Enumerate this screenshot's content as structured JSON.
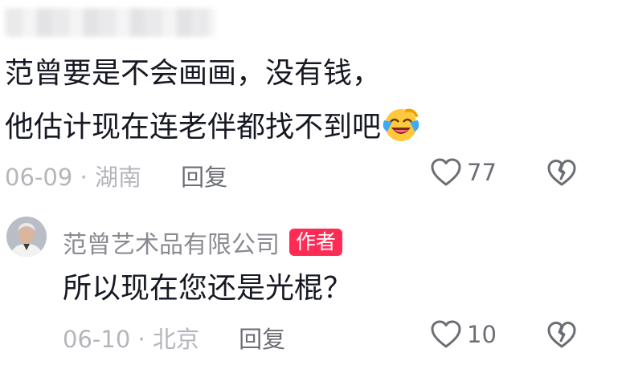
{
  "comment": {
    "text_line1": "范曾要是不会画画，没有钱，",
    "text_line2": "他估计现在连老伴都找不到吧",
    "emoji": "laughing-crying-emoji",
    "date": "06-09",
    "separator": " · ",
    "location": "湖南",
    "reply_label": "回复",
    "like_count": "77"
  },
  "reply": {
    "author": "范曾艺术品有限公司",
    "author_badge": "作者",
    "text": "所以现在您还是光棍？",
    "date": "06-10",
    "separator": " · ",
    "location": "北京",
    "reply_label": "回复",
    "like_count": "10"
  },
  "colors": {
    "badge": "#fe2c55",
    "meta_text": "#b4b6bb",
    "icon": "#6c6e75"
  }
}
